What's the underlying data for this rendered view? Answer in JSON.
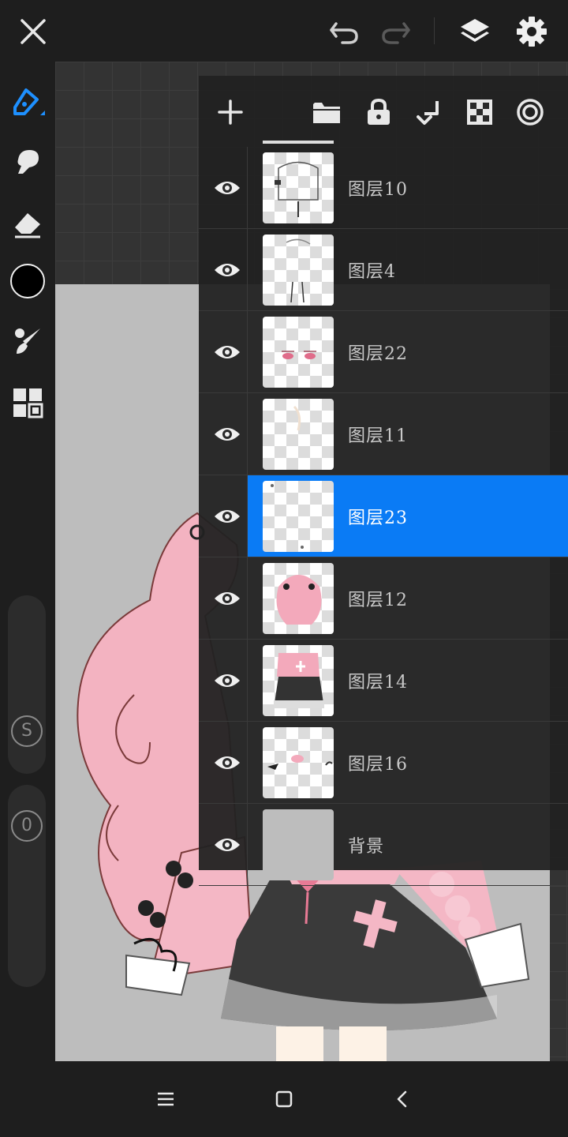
{
  "top_bar": {
    "icons": [
      "close-icon",
      "undo-icon",
      "redo-icon",
      "layers-icon",
      "settings-icon"
    ]
  },
  "left_toolbar": {
    "tools": [
      "pen-icon",
      "smudge-icon",
      "eraser-icon",
      "color-picker",
      "brush-settings-icon",
      "grid-icon"
    ],
    "current_color": "#000000",
    "size_label": "S",
    "opacity_label": "0"
  },
  "layers_panel": {
    "toolbar_icons": [
      "add-layer-icon",
      "folder-icon",
      "lock-icon",
      "merge-down-icon",
      "transparency-icon",
      "target-icon"
    ],
    "layers": [
      {
        "name": "图层10",
        "visible": true,
        "selected": false
      },
      {
        "name": "图层4",
        "visible": true,
        "selected": false
      },
      {
        "name": "图层22",
        "visible": true,
        "selected": false
      },
      {
        "name": "图层11",
        "visible": true,
        "selected": false
      },
      {
        "name": "图层23",
        "visible": true,
        "selected": true
      },
      {
        "name": "图层12",
        "visible": true,
        "selected": false
      },
      {
        "name": "图层14",
        "visible": true,
        "selected": false
      },
      {
        "name": "图层16",
        "visible": true,
        "selected": false
      },
      {
        "name": "背景",
        "visible": true,
        "selected": false
      }
    ],
    "accent_color": "#0a7bf5"
  },
  "nav_bar": {
    "icons": [
      "menu-icon",
      "home-icon",
      "back-icon"
    ]
  }
}
